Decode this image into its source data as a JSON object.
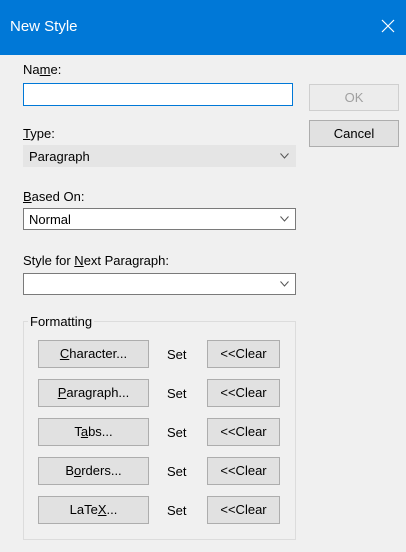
{
  "window": {
    "title": "New Style"
  },
  "name_field": {
    "label_pre": "Na",
    "label_ul": "m",
    "label_post": "e:",
    "value": ""
  },
  "type_field": {
    "label_pre": "",
    "label_ul": "T",
    "label_post": "ype:",
    "selected": "Paragraph"
  },
  "based_on": {
    "label_pre": "",
    "label_ul": "B",
    "label_post": "ased On:",
    "selected": "Normal"
  },
  "next_style": {
    "label_pre": "Style for ",
    "label_ul": "N",
    "label_post": "ext Paragraph:",
    "selected": ""
  },
  "buttons": {
    "ok": "OK",
    "cancel": "Cancel"
  },
  "formatting": {
    "label": "Formatting",
    "rows": [
      {
        "pre": "",
        "ul": "C",
        "post": "haracter...",
        "status": "Set",
        "clear": "<<Clear"
      },
      {
        "pre": "",
        "ul": "P",
        "post": "aragraph...",
        "status": "Set",
        "clear": "<<Clear"
      },
      {
        "pre": "T",
        "ul": "a",
        "post": "bs...",
        "status": "Set",
        "clear": "<<Clear"
      },
      {
        "pre": "B",
        "ul": "o",
        "post": "rders...",
        "status": "Set",
        "clear": "<<Clear"
      },
      {
        "pre": "LaTe",
        "ul": "X",
        "post": "...",
        "status": "Set",
        "clear": "<<Clear"
      }
    ]
  }
}
